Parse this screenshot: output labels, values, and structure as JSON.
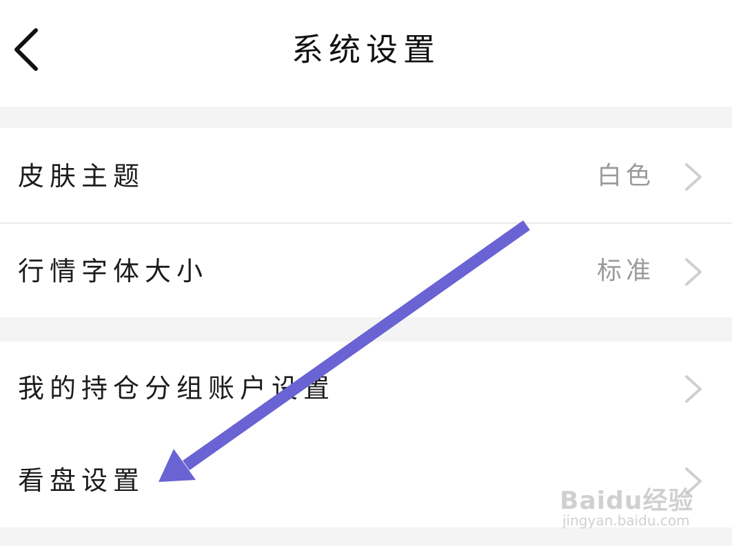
{
  "header": {
    "title": "系统设置",
    "back_icon": "chevron-left-icon"
  },
  "groups": [
    {
      "rows": [
        {
          "label": "皮肤主题",
          "value": "白色",
          "icon": "chevron-right-icon"
        },
        {
          "label": "行情字体大小",
          "value": "标准",
          "icon": "chevron-right-icon"
        }
      ]
    },
    {
      "rows": [
        {
          "label": "我的持仓分组账户设置",
          "value": "",
          "icon": "chevron-right-icon"
        },
        {
          "label": "看盘设置",
          "value": "",
          "icon": "chevron-right-icon"
        }
      ]
    }
  ],
  "annotation": {
    "arrow_color": "#6a63d3"
  },
  "watermark": {
    "logo": "Baidu经验",
    "url": "jingyan.baidu.com"
  },
  "colors": {
    "background": "#f4f4f4",
    "surface": "#ffffff",
    "text_primary": "#1c1c1c",
    "text_secondary": "#9a9a9a",
    "chevron": "#cfcfcf"
  }
}
